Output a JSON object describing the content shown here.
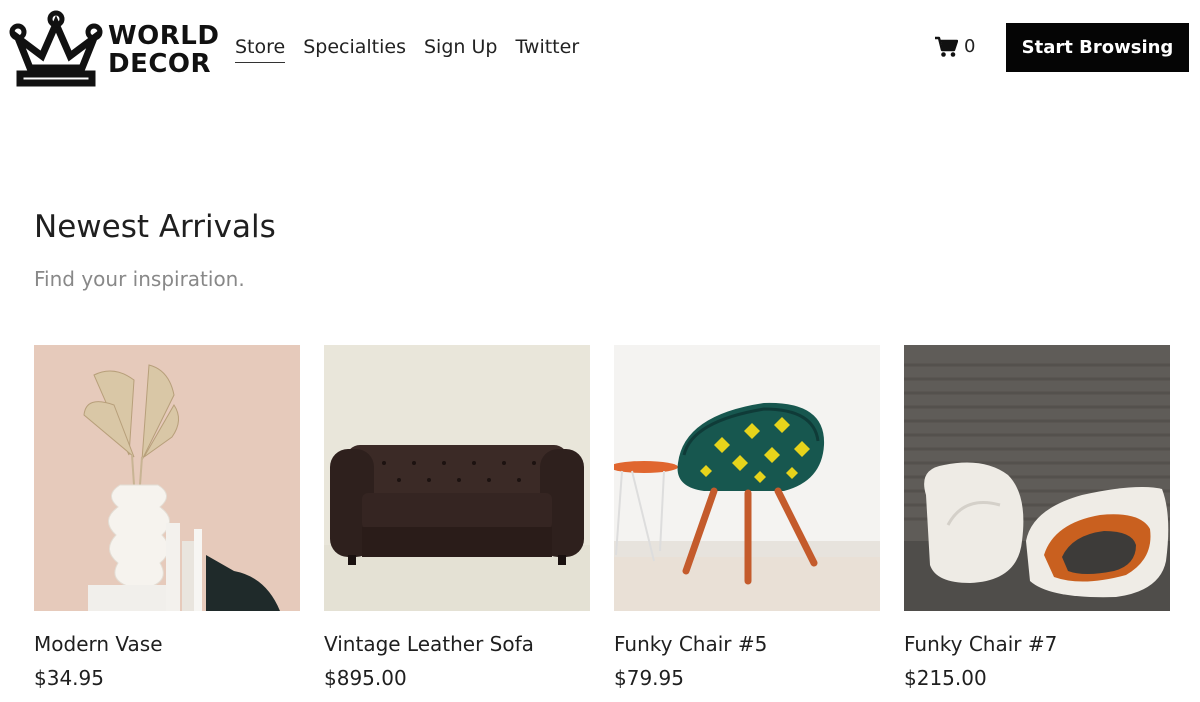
{
  "brand": {
    "line1": "WORLD",
    "line2": "DECOR"
  },
  "nav": [
    {
      "label": "Store"
    },
    {
      "label": "Specialties"
    },
    {
      "label": "Sign Up"
    },
    {
      "label": "Twitter"
    }
  ],
  "cart": {
    "count": "0",
    "icon": "cart-icon"
  },
  "cta": {
    "label": "Start Browsing"
  },
  "section": {
    "title": "Newest Arrivals",
    "subtitle": "Find your inspiration."
  },
  "products": [
    {
      "name": "Modern Vase",
      "price": "$34.95"
    },
    {
      "name": "Vintage Leather Sofa",
      "price": "$895.00"
    },
    {
      "name": "Funky Chair #5",
      "price": "$79.95"
    },
    {
      "name": "Funky Chair #7",
      "price": "$215.00"
    }
  ],
  "colors": {
    "cta_bg": "#050505",
    "text": "#1c1c1c",
    "subtle": "#888888"
  }
}
